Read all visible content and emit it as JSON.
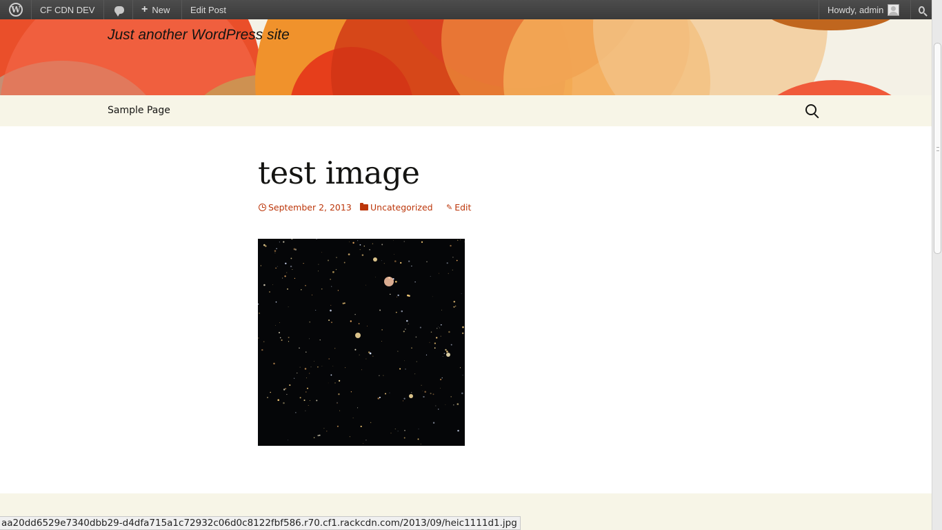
{
  "admin_bar": {
    "site_name": "CF CDN DEV",
    "new_label": "New",
    "new_plus": "+",
    "edit_post": "Edit Post",
    "howdy": "Howdy, admin"
  },
  "header": {
    "tagline": "Just another WordPress site",
    "colors": {
      "background": "#f4f1e6",
      "orange_dark": "#e63e1b",
      "orange": "#f28a2c",
      "light": "#f2b86e"
    }
  },
  "nav": {
    "items": [
      {
        "label": "Sample Page"
      }
    ]
  },
  "post": {
    "title": "test image",
    "date": "September 2, 2013",
    "category": "Uncategorized",
    "edit": "Edit",
    "edit_icon": "✎",
    "accent": "#bc360a"
  },
  "status_bar": {
    "url": "aa20dd6529e7340dbb29-d4dfa715a1c72932c06d0c8122fbf586.r70.cf1.rackcdn.com/2013/09/heic1111d1.jpg"
  }
}
